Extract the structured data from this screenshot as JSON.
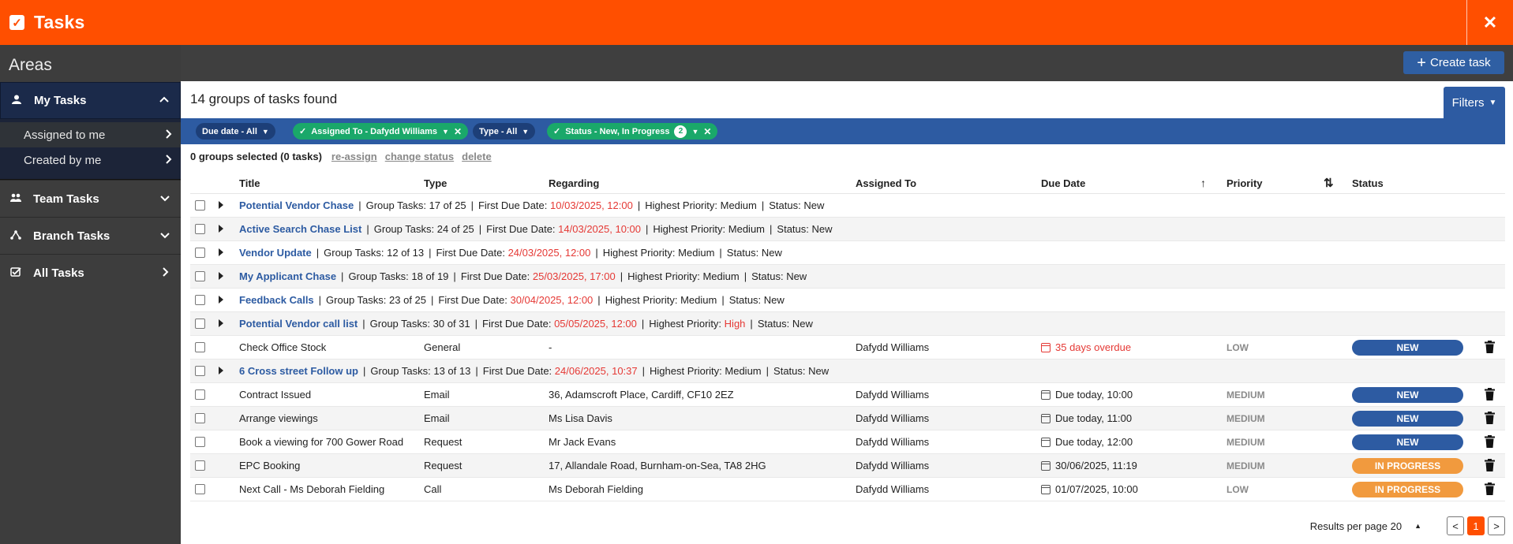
{
  "header": {
    "title": "Tasks",
    "close_label": "✕"
  },
  "sidebar": {
    "heading": "Areas",
    "items": [
      {
        "label": "My Tasks",
        "icon": "user-icon"
      },
      {
        "label": "Team Tasks",
        "icon": "team-icon"
      },
      {
        "label": "Branch Tasks",
        "icon": "branch-icon"
      },
      {
        "label": "All Tasks",
        "icon": "checklist-icon"
      }
    ],
    "subitems": [
      {
        "label": "Assigned to me"
      },
      {
        "label": "Created by me"
      }
    ]
  },
  "toolbar": {
    "create_label": "Create task"
  },
  "results": {
    "found_text": "14 groups of tasks found",
    "filters_label": "Filters"
  },
  "filters": {
    "due_date": "Due date - All",
    "assigned_to": "Assigned To - Dafydd Williams",
    "type": "Type - All",
    "status": "Status - New, In Progress",
    "status_count": "2"
  },
  "selection": {
    "summary": "0 groups selected (0 tasks)",
    "reassign": "re-assign",
    "change_status": "change status",
    "delete": "delete"
  },
  "columns": {
    "title": "Title",
    "type": "Type",
    "regarding": "Regarding",
    "assigned_to": "Assigned To",
    "due_date": "Due Date",
    "priority": "Priority",
    "status": "Status"
  },
  "labels": {
    "group_tasks": "Group Tasks:",
    "first_due": "First Due Date:",
    "highest_priority": "Highest Priority:",
    "status": "Status:"
  },
  "rows": [
    {
      "kind": "group",
      "name": "Potential Vendor Chase",
      "tasks": "17 of 25",
      "due": "10/03/2025, 12:00",
      "priority": "Medium",
      "status": "New"
    },
    {
      "kind": "group",
      "name": "Active Search Chase List",
      "tasks": "24 of 25",
      "due": "14/03/2025, 10:00",
      "priority": "Medium",
      "status": "New"
    },
    {
      "kind": "group",
      "name": "Vendor Update",
      "tasks": "12 of 13",
      "due": "24/03/2025, 12:00",
      "priority": "Medium",
      "status": "New"
    },
    {
      "kind": "group",
      "name": "My Applicant Chase",
      "tasks": "18 of 19",
      "due": "25/03/2025, 17:00",
      "priority": "Medium",
      "status": "New"
    },
    {
      "kind": "group",
      "name": "Feedback Calls",
      "tasks": "23 of 25",
      "due": "30/04/2025, 12:00",
      "priority": "Medium",
      "status": "New"
    },
    {
      "kind": "group",
      "name": "Potential Vendor call list",
      "tasks": "30 of 31",
      "due": "05/05/2025, 12:00",
      "priority": "High",
      "status": "New"
    },
    {
      "kind": "task",
      "title": "Check Office Stock",
      "type": "General",
      "regarding": "-",
      "assigned": "Dafydd Williams",
      "due": "35 days overdue",
      "overdue": true,
      "priority": "LOW",
      "status": "NEW"
    },
    {
      "kind": "group",
      "name": "6 Cross street Follow up",
      "tasks": "13 of 13",
      "due": "24/06/2025, 10:37",
      "priority": "Medium",
      "status": "New"
    },
    {
      "kind": "task",
      "title": "Contract Issued",
      "type": "Email",
      "regarding": "36, Adamscroft Place, Cardiff, CF10 2EZ",
      "assigned": "Dafydd Williams",
      "due": "Due today, 10:00",
      "overdue": false,
      "priority": "MEDIUM",
      "status": "NEW"
    },
    {
      "kind": "task",
      "title": "Arrange viewings",
      "type": "Email",
      "regarding": "Ms Lisa Davis",
      "assigned": "Dafydd Williams",
      "due": "Due today, 11:00",
      "overdue": false,
      "priority": "MEDIUM",
      "status": "NEW"
    },
    {
      "kind": "task",
      "title": "Book a viewing for 700 Gower Road",
      "type": "Request",
      "regarding": "Mr Jack Evans",
      "assigned": "Dafydd Williams",
      "due": "Due today, 12:00",
      "overdue": false,
      "priority": "MEDIUM",
      "status": "NEW"
    },
    {
      "kind": "task",
      "title": "EPC Booking",
      "type": "Request",
      "regarding": "17, Allandale Road, Burnham-on-Sea, TA8 2HG",
      "assigned": "Dafydd Williams",
      "due": "30/06/2025, 11:19",
      "overdue": false,
      "priority": "MEDIUM",
      "status": "IN PROGRESS"
    },
    {
      "kind": "task",
      "title": "Next Call - Ms Deborah Fielding",
      "type": "Call",
      "regarding": "Ms Deborah Fielding",
      "assigned": "Dafydd Williams",
      "due": "01/07/2025, 10:00",
      "overdue": false,
      "priority": "LOW",
      "status": "IN PROGRESS"
    }
  ],
  "pagination": {
    "label": "Results per page 20",
    "prev": "<",
    "current": "1",
    "next": ">"
  }
}
